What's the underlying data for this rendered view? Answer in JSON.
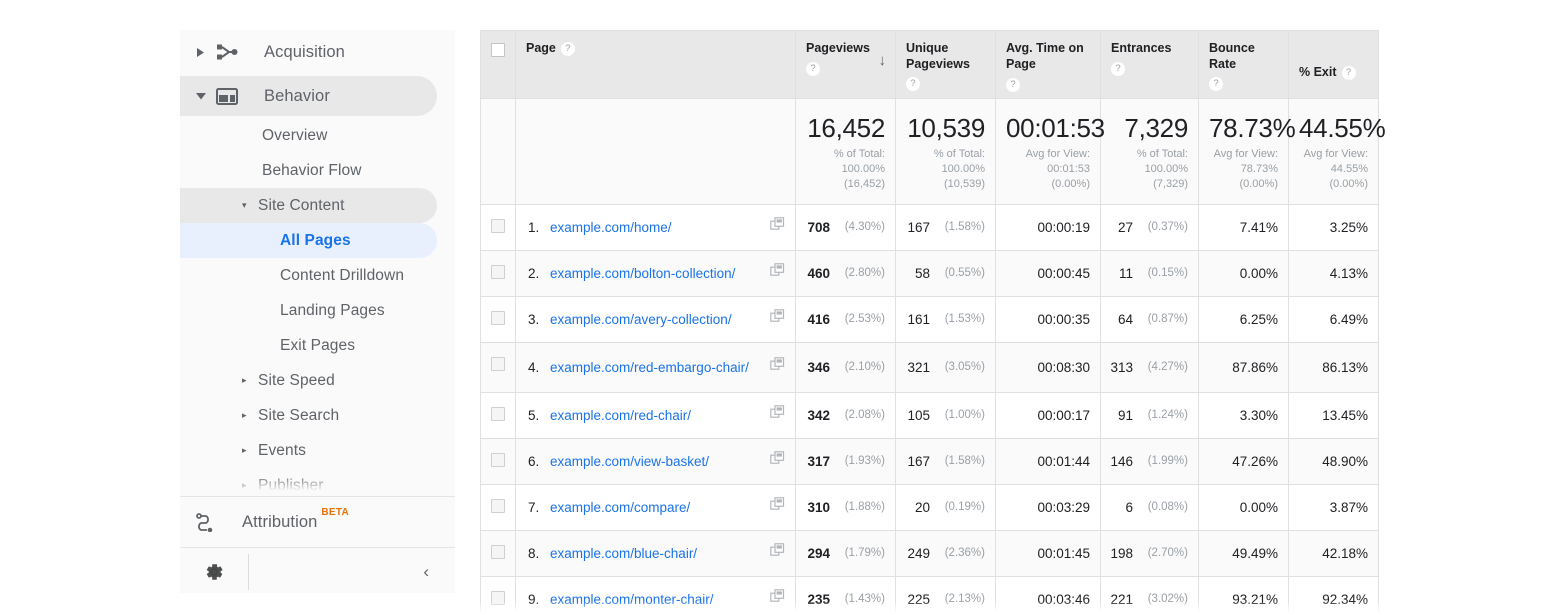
{
  "sidebar": {
    "nav_top": [
      {
        "label": "Acquisition",
        "icon": "acquisition-icon",
        "expanded": false
      },
      {
        "label": "Behavior",
        "icon": "behavior-icon",
        "expanded": true
      }
    ],
    "behavior_children": [
      {
        "label": "Overview",
        "level": 2,
        "state": "normal"
      },
      {
        "label": "Behavior Flow",
        "level": 2,
        "state": "normal"
      },
      {
        "label": "Site Content",
        "level": 2,
        "state": "group-open",
        "caret": "▾"
      },
      {
        "label": "All Pages",
        "level": 3,
        "state": "selected"
      },
      {
        "label": "Content Drilldown",
        "level": 3,
        "state": "normal"
      },
      {
        "label": "Landing Pages",
        "level": 3,
        "state": "normal"
      },
      {
        "label": "Exit Pages",
        "level": 3,
        "state": "normal"
      },
      {
        "label": "Site Speed",
        "level": 2,
        "state": "group-closed",
        "caret": "▸"
      },
      {
        "label": "Site Search",
        "level": 2,
        "state": "group-closed",
        "caret": "▸"
      },
      {
        "label": "Events",
        "level": 2,
        "state": "group-closed",
        "caret": "▸"
      },
      {
        "label": "Publisher",
        "level": 2,
        "state": "group-closed",
        "caret": "▸"
      }
    ],
    "attribution": {
      "label": "Attribution",
      "badge": "BETA",
      "icon": "attribution-icon"
    },
    "footer": {
      "settings_icon": "gear-icon",
      "collapse_icon": "chevron-left-icon",
      "collapse_glyph": "‹"
    }
  },
  "table": {
    "select_all_checkbox": "select-all-checkbox",
    "sort_indicator": "↓",
    "help_glyph": "?",
    "columns": [
      {
        "label": "Page",
        "help": true,
        "sorted": false
      },
      {
        "label": "Pageviews",
        "help": true,
        "sorted": true
      },
      {
        "label": "Unique Pageviews",
        "help": true,
        "sorted": false
      },
      {
        "label": "Avg. Time on Page",
        "help": true,
        "sorted": false
      },
      {
        "label": "Entrances",
        "help": true,
        "sorted": false
      },
      {
        "label": "Bounce Rate",
        "help": true,
        "sorted": false
      },
      {
        "label": "% Exit",
        "help": true,
        "sorted": false
      }
    ],
    "summary": [
      {
        "value": "16,452",
        "line1": "% of Total:",
        "line2": "100.00%",
        "line3": "(16,452)"
      },
      {
        "value": "10,539",
        "line1": "% of Total:",
        "line2": "100.00%",
        "line3": "(10,539)"
      },
      {
        "value": "00:01:53",
        "line1": "Avg for View:",
        "line2": "00:01:53",
        "line3": "(0.00%)"
      },
      {
        "value": "7,329",
        "line1": "% of Total:",
        "line2": "100.00%",
        "line3": "(7,329)"
      },
      {
        "value": "78.73%",
        "line1": "Avg for View:",
        "line2": "78.73%",
        "line3": "(0.00%)"
      },
      {
        "value": "44.55%",
        "line1": "Avg for View:",
        "line2": "44.55%",
        "line3": "(0.00%)"
      }
    ],
    "rows": [
      {
        "index": "1.",
        "page": "example.com/home/",
        "pageviews": "708",
        "pageviews_pct": "(4.30%)",
        "unique": "167",
        "unique_pct": "(1.58%)",
        "avg_time": "00:00:19",
        "entrances": "27",
        "entrances_pct": "(0.37%)",
        "bounce_rate": "7.41%",
        "exit_pct": "3.25%"
      },
      {
        "index": "2.",
        "page": "example.com/bolton-collection/",
        "pageviews": "460",
        "pageviews_pct": "(2.80%)",
        "unique": "58",
        "unique_pct": "(0.55%)",
        "avg_time": "00:00:45",
        "entrances": "11",
        "entrances_pct": "(0.15%)",
        "bounce_rate": "0.00%",
        "exit_pct": "4.13%"
      },
      {
        "index": "3.",
        "page": "example.com/avery-collection/",
        "pageviews": "416",
        "pageviews_pct": "(2.53%)",
        "unique": "161",
        "unique_pct": "(1.53%)",
        "avg_time": "00:00:35",
        "entrances": "64",
        "entrances_pct": "(0.87%)",
        "bounce_rate": "6.25%",
        "exit_pct": "6.49%"
      },
      {
        "index": "4.",
        "page": "example.com/red-embargo-chair/",
        "pageviews": "346",
        "pageviews_pct": "(2.10%)",
        "unique": "321",
        "unique_pct": "(3.05%)",
        "avg_time": "00:08:30",
        "entrances": "313",
        "entrances_pct": "(4.27%)",
        "bounce_rate": "87.86%",
        "exit_pct": "86.13%"
      },
      {
        "index": "5.",
        "page": "example.com/red-chair/",
        "pageviews": "342",
        "pageviews_pct": "(2.08%)",
        "unique": "105",
        "unique_pct": "(1.00%)",
        "avg_time": "00:00:17",
        "entrances": "91",
        "entrances_pct": "(1.24%)",
        "bounce_rate": "3.30%",
        "exit_pct": "13.45%"
      },
      {
        "index": "6.",
        "page": "example.com/view-basket/",
        "pageviews": "317",
        "pageviews_pct": "(1.93%)",
        "unique": "167",
        "unique_pct": "(1.58%)",
        "avg_time": "00:01:44",
        "entrances": "146",
        "entrances_pct": "(1.99%)",
        "bounce_rate": "47.26%",
        "exit_pct": "48.90%"
      },
      {
        "index": "7.",
        "page": "example.com/compare/",
        "pageviews": "310",
        "pageviews_pct": "(1.88%)",
        "unique": "20",
        "unique_pct": "(0.19%)",
        "avg_time": "00:03:29",
        "entrances": "6",
        "entrances_pct": "(0.08%)",
        "bounce_rate": "0.00%",
        "exit_pct": "3.87%"
      },
      {
        "index": "8.",
        "page": "example.com/blue-chair/",
        "pageviews": "294",
        "pageviews_pct": "(1.79%)",
        "unique": "249",
        "unique_pct": "(2.36%)",
        "avg_time": "00:01:45",
        "entrances": "198",
        "entrances_pct": "(2.70%)",
        "bounce_rate": "49.49%",
        "exit_pct": "42.18%"
      },
      {
        "index": "9.",
        "page": "example.com/monter-chair/",
        "pageviews": "235",
        "pageviews_pct": "(1.43%)",
        "unique": "225",
        "unique_pct": "(2.13%)",
        "avg_time": "00:03:46",
        "entrances": "221",
        "entrances_pct": "(3.02%)",
        "bounce_rate": "93.21%",
        "exit_pct": "92.34%"
      }
    ]
  },
  "colors": {
    "accent_blue": "#1a73e8",
    "selected_bg": "#e8f0fe",
    "beta_orange": "#e8710a",
    "header_bg": "#e8e8e8",
    "sidebar_bg": "#fafafa"
  }
}
